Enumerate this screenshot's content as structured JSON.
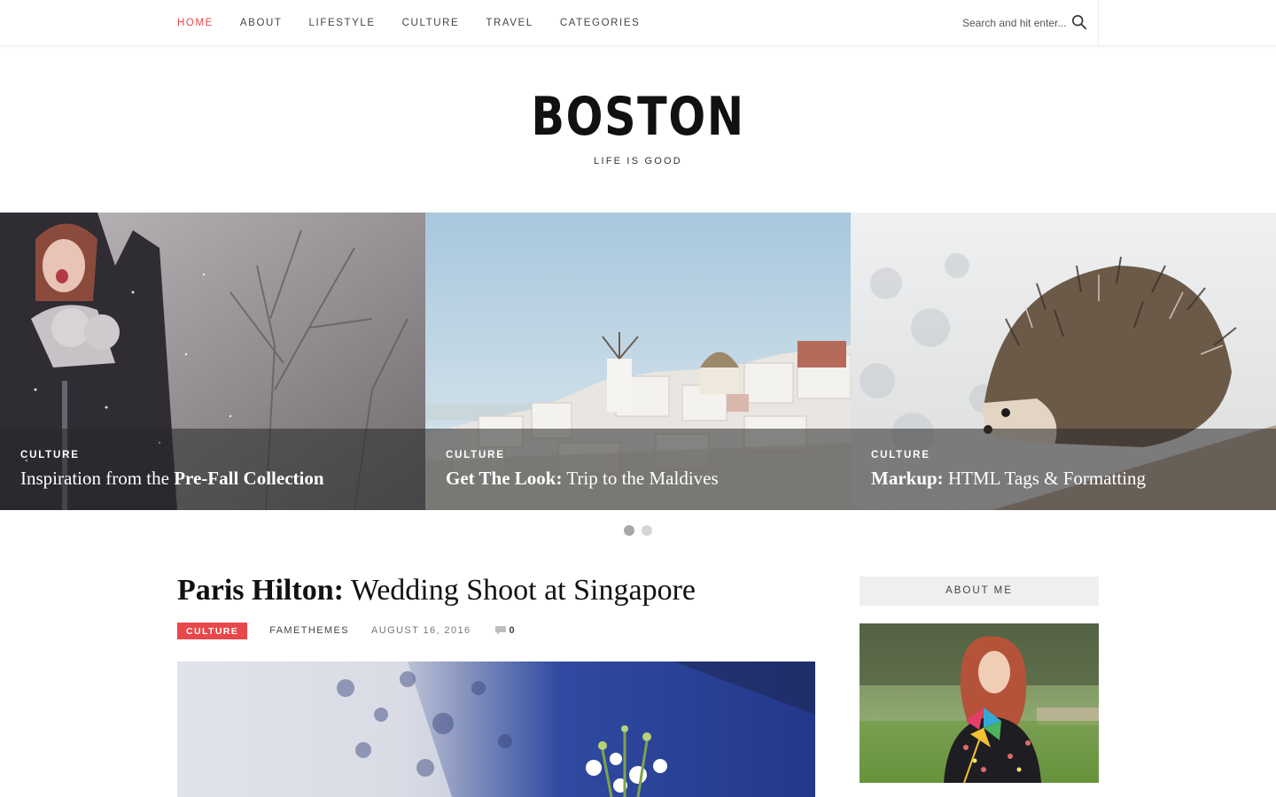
{
  "nav": {
    "items": [
      {
        "label": "Home",
        "active": true
      },
      {
        "label": "About",
        "active": false
      },
      {
        "label": "Lifestyle",
        "active": false
      },
      {
        "label": "Culture",
        "active": false
      },
      {
        "label": "Travel",
        "active": false
      },
      {
        "label": "Categories",
        "active": false
      }
    ],
    "search_placeholder": "Search and hit enter...",
    "search_icon": "magnifier-icon"
  },
  "site": {
    "title": "BOSTON",
    "tagline": "Life is good"
  },
  "slider": {
    "slides": [
      {
        "category": "Culture",
        "title_plain_before": "Inspiration from the ",
        "title_bold": "Pre-Fall Collection",
        "title_plain_after": "",
        "image": "girl in snow"
      },
      {
        "category": "Culture",
        "title_plain_before": "",
        "title_bold": "Get The Look:",
        "title_plain_after": " Trip to the Maldives",
        "image": "white village with windmill"
      },
      {
        "category": "Culture",
        "title_plain_before": "",
        "title_bold": "Markup:",
        "title_plain_after": " HTML Tags & Formatting",
        "image": "hedgehog"
      }
    ],
    "pagination": [
      {
        "active": true
      },
      {
        "active": false
      }
    ]
  },
  "post": {
    "title_bold": "Paris Hilton:",
    "title_rest": " Wedding Shoot at Singapore",
    "category": "Culture",
    "author": "FameThemes",
    "date": "August 16, 2016",
    "comments": "0",
    "comment_icon": "speech-bubble-icon"
  },
  "sidebar": {
    "widget_title": "About Me"
  },
  "colors": {
    "accent": "#e8484b",
    "caption_overlay": "rgba(40,40,40,0.55)",
    "widget_bg": "#efefef"
  }
}
